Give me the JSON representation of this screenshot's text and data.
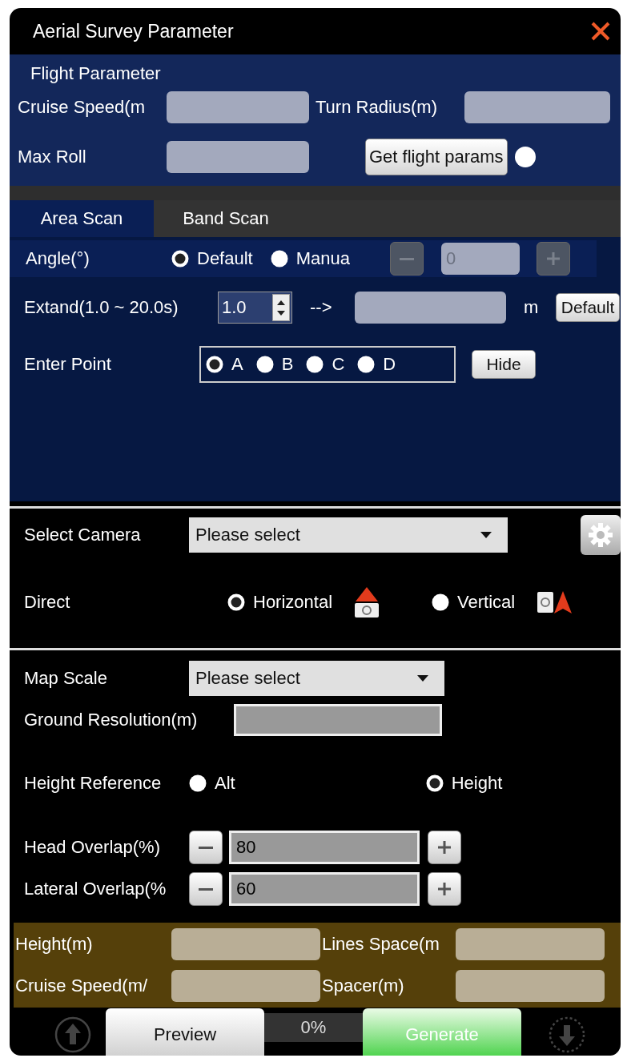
{
  "window": {
    "title": "Aerial Survey Parameter"
  },
  "flight_parameter": {
    "heading": "Flight Parameter",
    "cruise_speed_label": "Cruise Speed(m",
    "turn_radius_label": "Turn Radius(m)",
    "max_roll_label": "Max Roll",
    "get_button": "Get flight params"
  },
  "tabs": [
    {
      "label": "Area Scan",
      "selected": true
    },
    {
      "label": "Band Scan",
      "selected": false
    }
  ],
  "angle": {
    "label": "Angle(°)",
    "options": [
      {
        "label": "Default",
        "selected": true
      },
      {
        "label": "Manua",
        "selected": false
      }
    ],
    "value": "0",
    "disabled": true
  },
  "extend": {
    "label": "Extand(1.0 ~ 20.0s)",
    "value": "1.0",
    "arrow": "-->",
    "unit": "m",
    "button": "Default"
  },
  "enter_point": {
    "label": "Enter Point",
    "options": [
      {
        "label": "A",
        "selected": true
      },
      {
        "label": "B",
        "selected": false
      },
      {
        "label": "C",
        "selected": false
      },
      {
        "label": "D",
        "selected": false
      }
    ],
    "button": "Hide"
  },
  "camera": {
    "label": "Select Camera",
    "value": "Please select"
  },
  "direct": {
    "label": "Direct",
    "options": [
      {
        "label": "Horizontal",
        "selected": true
      },
      {
        "label": "Vertical",
        "selected": false
      }
    ]
  },
  "map_scale": {
    "label": "Map Scale",
    "value": "Please select"
  },
  "ground_resolution": {
    "label": "Ground Resolution(m)"
  },
  "height_reference": {
    "label": "Height Reference",
    "options": [
      {
        "label": "Alt",
        "selected": false
      },
      {
        "label": "Height",
        "selected": true
      }
    ]
  },
  "overlaps": [
    {
      "label": "Head Overlap(%)",
      "value": "80"
    },
    {
      "label": "Lateral Overlap(%",
      "value": "60"
    }
  ],
  "results": [
    {
      "label": "Height(m)"
    },
    {
      "label": "Lines Space(m"
    },
    {
      "label": "Cruise Speed(m/"
    },
    {
      "label": "Spacer(m)"
    }
  ],
  "footer": {
    "preview": "Preview",
    "progress": "0%",
    "generate": "Generate"
  }
}
